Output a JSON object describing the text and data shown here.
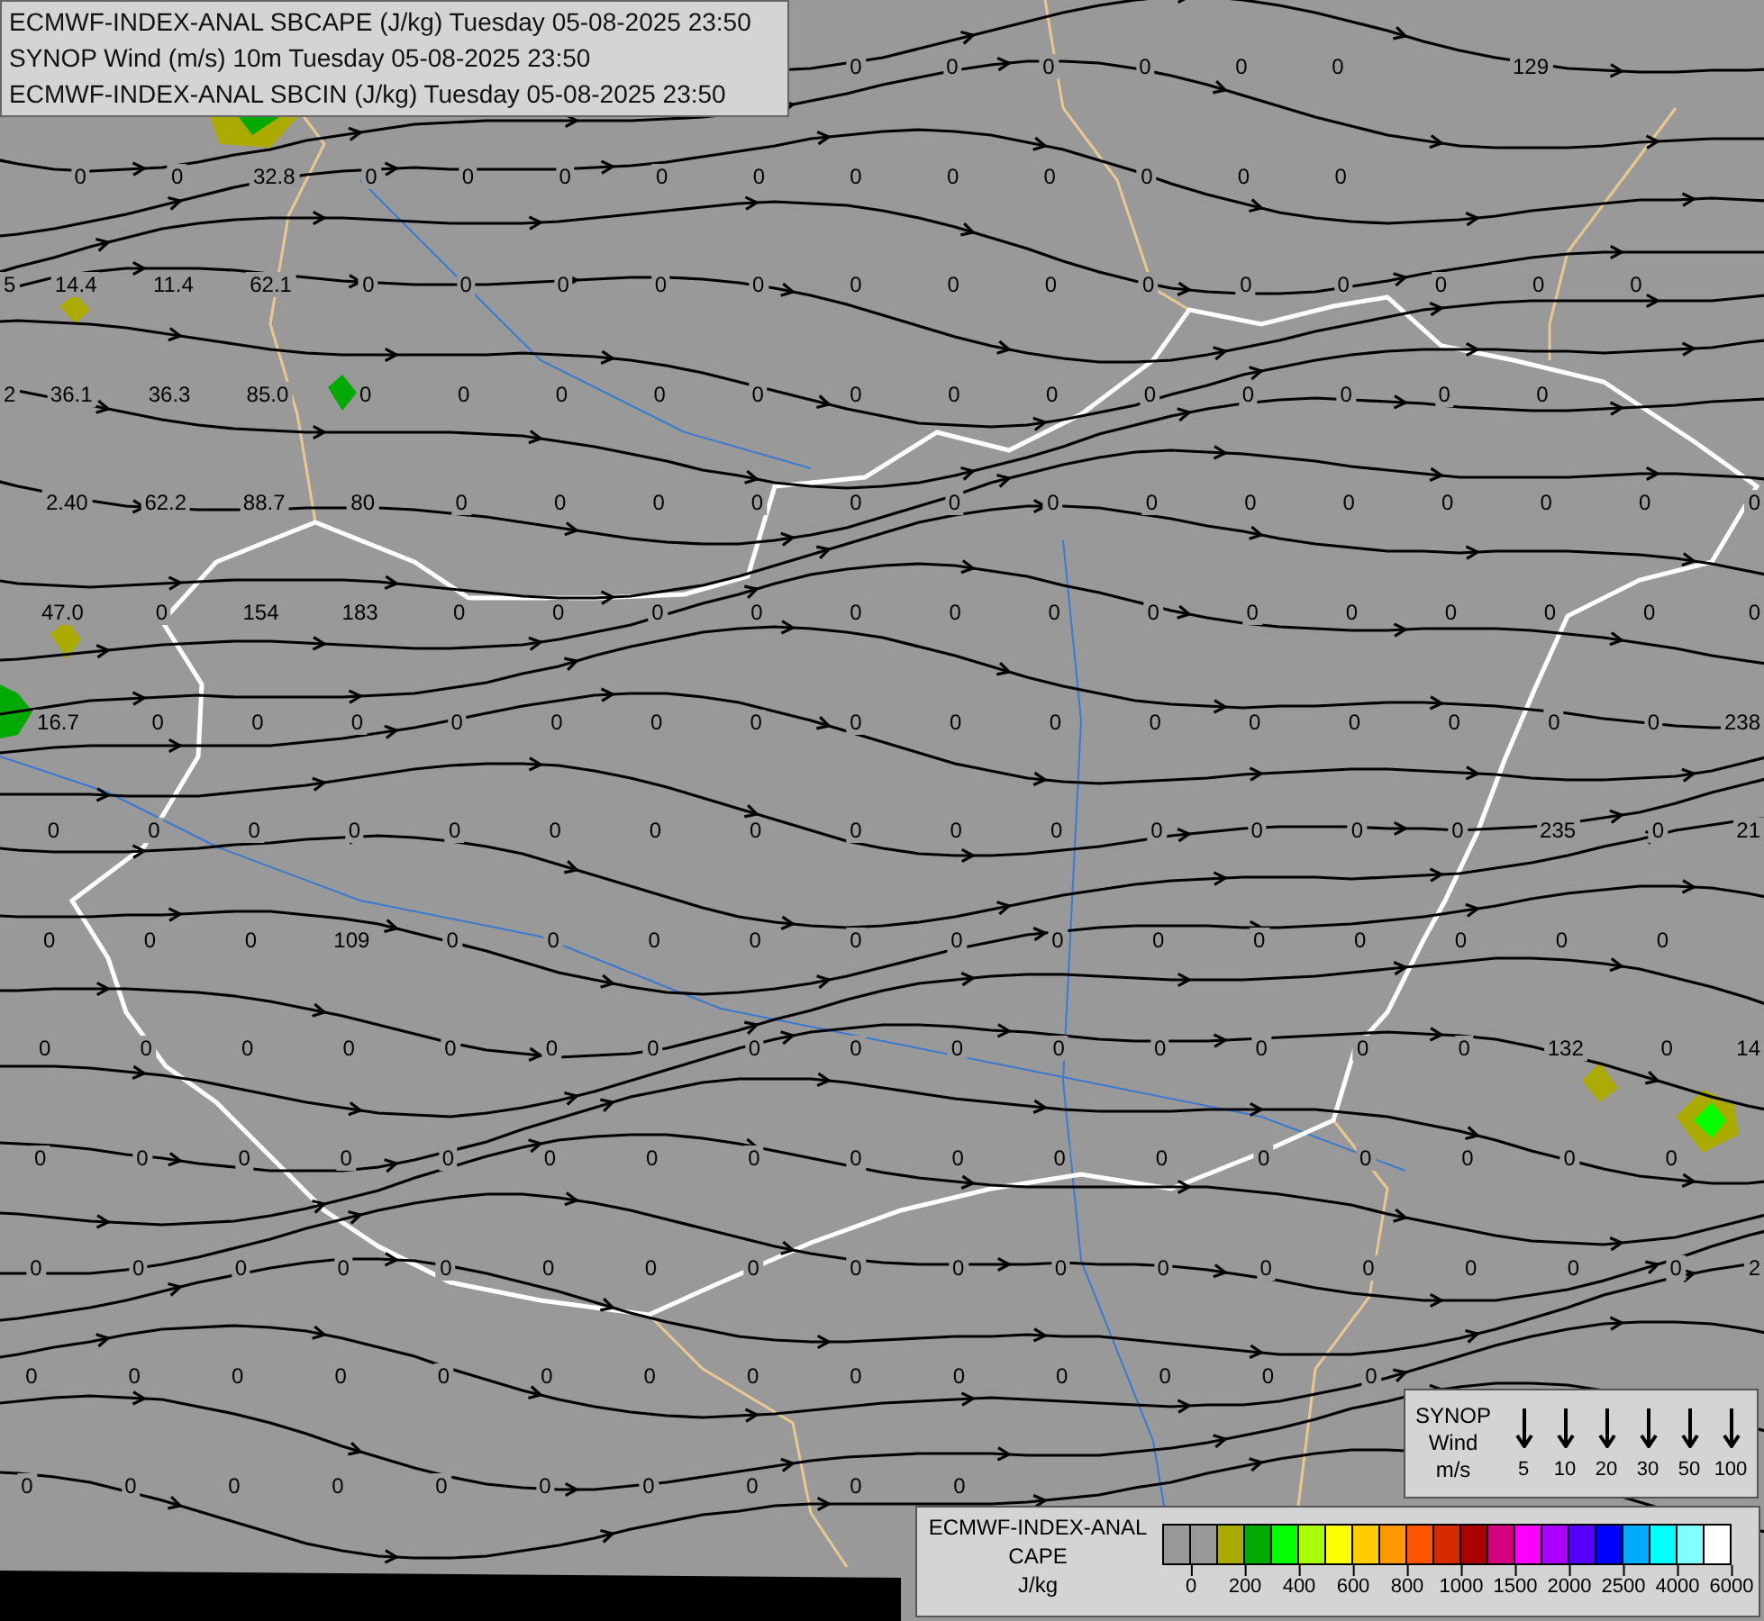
{
  "layer_titles": [
    "ECMWF-INDEX-ANAL SBCAPE (J/kg) Tuesday 05-08-2025 23:50",
    "SYNOP Wind (m/s) 10m Tuesday 05-08-2025 23:50",
    "ECMWF-INDEX-ANAL SBCIN (J/kg) Tuesday 05-08-2025 23:50"
  ],
  "station_values": [
    "0",
    "0",
    "0",
    "0",
    "0",
    "0",
    "129",
    "0",
    "0",
    "32.8",
    "0",
    "0",
    "0",
    "0",
    "0",
    "0",
    "0",
    "0",
    "0",
    "0",
    "0",
    "5",
    "14.4",
    "11.4",
    "62.1",
    "0",
    "0",
    "0",
    "0",
    "0",
    "0",
    "0",
    "0",
    "0",
    "0",
    "0",
    "0",
    "0",
    "0",
    "2",
    "36.1",
    "36.3",
    "85.0",
    "0",
    "0",
    "0",
    "0",
    "0",
    "0",
    "0",
    "0",
    "0",
    "0",
    "0",
    "0",
    "0",
    "2.40",
    "62.2",
    "88.7",
    "80",
    "0",
    "0",
    "0",
    "0",
    "0",
    "0",
    "0",
    "0",
    "0",
    "0",
    "0",
    "0",
    "0",
    "0",
    "47.0",
    "0",
    "154",
    "183",
    "0",
    "0",
    "0",
    "0",
    "0",
    "0",
    "0",
    "0",
    "0",
    "0",
    "0",
    "0",
    "0",
    "0",
    "16.7",
    "0",
    "0",
    "0",
    "0",
    "0",
    "0",
    "0",
    "0",
    "0",
    "0",
    "0",
    "0",
    "0",
    "0",
    "0",
    "0",
    "238",
    "0",
    "0",
    "0",
    "0",
    "0",
    "0",
    "0",
    "0",
    "0",
    "0",
    "0",
    "0",
    "0",
    "0",
    "0",
    "235",
    "0",
    "21",
    "0",
    "0",
    "0",
    "109",
    "0",
    "0",
    "0",
    "0",
    "0",
    "0",
    "0",
    "0",
    "0",
    "0",
    "0",
    "0",
    "0",
    "0",
    "0",
    "0",
    "0",
    "0",
    "0",
    "0",
    "0",
    "0",
    "0",
    "0",
    "0",
    "0",
    "0",
    "0",
    "132",
    "0",
    "14",
    "0",
    "0",
    "0",
    "0",
    "0",
    "0",
    "0",
    "0",
    "0",
    "0",
    "0",
    "0",
    "0",
    "0",
    "0",
    "0",
    "0",
    "0",
    "0",
    "0",
    "0",
    "0",
    "0",
    "0",
    "0",
    "0",
    "0",
    "0",
    "0",
    "0",
    "0",
    "0",
    "0",
    "0",
    "2",
    "0",
    "0",
    "0",
    "0",
    "0",
    "0",
    "0",
    "0",
    "0",
    "0",
    "0",
    "0",
    "0",
    "0",
    "0",
    "0",
    "0",
    "0",
    "0",
    "0",
    "0",
    "0",
    "0",
    "0"
  ],
  "synop_legend": {
    "label_lines": [
      "SYNOP",
      "Wind",
      "m/s"
    ],
    "speeds": [
      "5",
      "10",
      "20",
      "30",
      "50",
      "100"
    ]
  },
  "cape_legend": {
    "title_lines": [
      "ECMWF-INDEX-ANAL",
      "CAPE"
    ],
    "unit": "J/kg",
    "colors": [
      {
        "color": "#999999"
      },
      {
        "color": "#999999"
      },
      {
        "color": "#aaaa00"
      },
      {
        "color": "#00aa00"
      },
      {
        "color": "#00ff00"
      },
      {
        "color": "#aaff00"
      },
      {
        "color": "#ffff00"
      },
      {
        "color": "#ffcc00"
      },
      {
        "color": "#ff9900"
      },
      {
        "color": "#ff5500"
      },
      {
        "color": "#d42a00"
      },
      {
        "color": "#aa0000"
      },
      {
        "color": "#d4007f"
      },
      {
        "color": "#ff00ff"
      },
      {
        "color": "#aa00ff"
      },
      {
        "color": "#5500ff"
      },
      {
        "color": "#0000ff"
      },
      {
        "color": "#00aaff"
      },
      {
        "color": "#00ffff"
      },
      {
        "color": "#80ffff"
      },
      {
        "color": "#ffffff"
      }
    ],
    "ticks": [
      "0",
      "200",
      "400",
      "600",
      "800",
      "1000",
      "1500",
      "2000",
      "2500",
      "4000",
      "6000"
    ]
  }
}
